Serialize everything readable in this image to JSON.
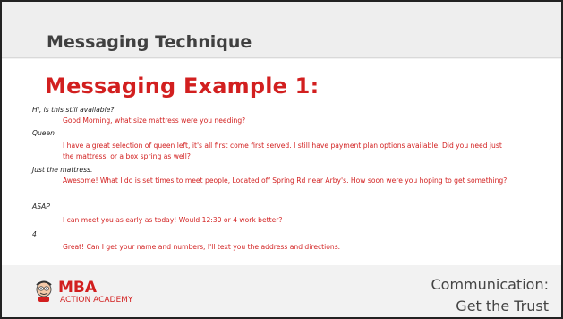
{
  "header": {
    "title": "Messaging Technique"
  },
  "main": {
    "example_title": "Messaging Example 1:",
    "messages": [
      {
        "from": "customer",
        "text": "Hi, is this still available?"
      },
      {
        "from": "seller",
        "text": "Good Morning, what size mattress were you needing?"
      },
      {
        "from": "customer",
        "text": "Queen"
      },
      {
        "from": "seller",
        "text": "I have a great selection of queen left, it's all first come first served. I still have payment plan options available. Did you need just the mattress, or a box spring as well?"
      },
      {
        "from": "customer",
        "text": "Just the mattress."
      },
      {
        "from": "seller",
        "text": "Awesome! What I do is set times to meet people, Located off Spring Rd near Arby's. How soon were you hoping to get something?"
      },
      {
        "from": "customer",
        "text": "ASAP"
      },
      {
        "from": "seller",
        "text": "I can meet you as early as today! Would 12:30 or 4 work better?"
      },
      {
        "from": "customer",
        "text": "4"
      },
      {
        "from": "seller",
        "text": "Great! Can I get your name and numbers, I'll text you the address and directions."
      }
    ]
  },
  "footer": {
    "logo_main": "MBA",
    "logo_sub": "ACTION ACADEMY",
    "logo_icon": "cartoon-mascot-icon",
    "subtitle_line1": "Communication:",
    "subtitle_line2": "Get the Trust"
  },
  "colors": {
    "accent_red": "#d21f1f",
    "text_dark": "#222222",
    "header_bg": "#eeeeee"
  }
}
